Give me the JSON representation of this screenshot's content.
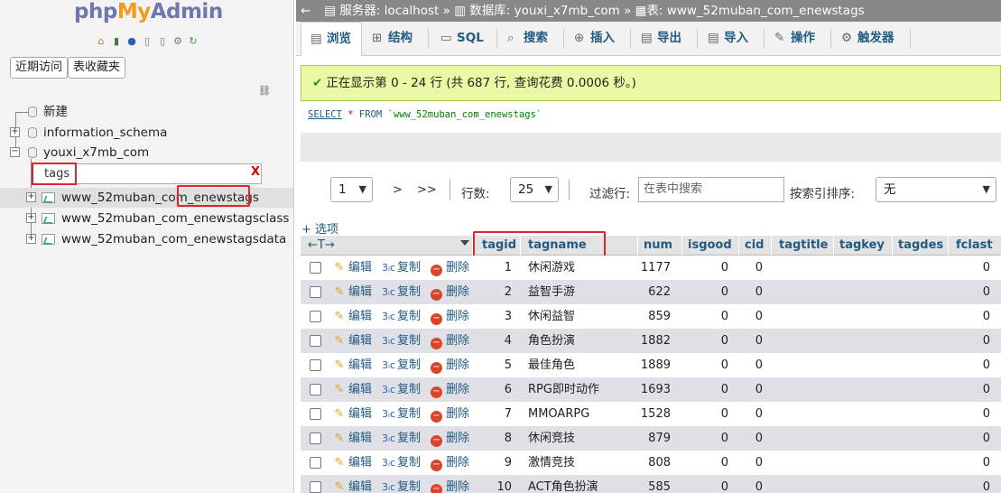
{
  "logo": {
    "php": "php",
    "my": "My",
    "admin": "Admin"
  },
  "nav": {
    "recent_btn": "近期访问",
    "favorites_btn": "表收藏夹",
    "new_label": "新建",
    "databases": [
      "information_schema",
      "youxi_x7mb_com"
    ],
    "filter_value": "tags",
    "filter_clear": "X",
    "tables": [
      "www_52muban_com_enewstags",
      "www_52muban_com_enewstagsclass",
      "www_52muban_com_enewstagsdata"
    ]
  },
  "breadcrumb": {
    "server_label": "服务器:",
    "server": "localhost",
    "db_label": "数据库:",
    "db": "youxi_x7mb_com",
    "table_label": "表:",
    "table": "www_52muban_com_enewstags",
    "separator": "»"
  },
  "tabs": [
    "浏览",
    "结构",
    "SQL",
    "搜索",
    "插入",
    "导出",
    "导入",
    "操作",
    "触发器"
  ],
  "message": {
    "text": "正在显示第 0 - 24 行 (共 687 行, 查询花费 0.0006 秒。)"
  },
  "sql": {
    "select": "SELECT",
    "star": "*",
    "from": "FROM",
    "table": "`www_52muban_com_enewstags`"
  },
  "controls": {
    "page": "1",
    "next": ">",
    "last": ">>",
    "rows_label": "行数:",
    "rows": "25",
    "filter_label": "过滤行:",
    "filter_placeholder": "在表中搜索",
    "sort_label": "按索引排序:",
    "sort_value": "无"
  },
  "options_link": "+ 选项",
  "columns": [
    "tagid",
    "tagname",
    "num",
    "isgood",
    "cid",
    "tagtitle",
    "tagkey",
    "tagdes",
    "fclast"
  ],
  "actions": {
    "edit": "编辑",
    "copy": "复制",
    "delete": "删除"
  },
  "rows": [
    {
      "tagid": "1",
      "tagname": "休闲游戏",
      "num": "1177",
      "isgood": "0",
      "cid": "0",
      "fclast": "0"
    },
    {
      "tagid": "2",
      "tagname": "益智手游",
      "num": "622",
      "isgood": "0",
      "cid": "0",
      "fclast": "0"
    },
    {
      "tagid": "3",
      "tagname": "休闲益智",
      "num": "859",
      "isgood": "0",
      "cid": "0",
      "fclast": "0"
    },
    {
      "tagid": "4",
      "tagname": "角色扮演",
      "num": "1882",
      "isgood": "0",
      "cid": "0",
      "fclast": "0"
    },
    {
      "tagid": "5",
      "tagname": "最佳角色",
      "num": "1889",
      "isgood": "0",
      "cid": "0",
      "fclast": "0"
    },
    {
      "tagid": "6",
      "tagname": "RPG即时动作",
      "num": "1693",
      "isgood": "0",
      "cid": "0",
      "fclast": "0"
    },
    {
      "tagid": "7",
      "tagname": "MMOARPG",
      "num": "1528",
      "isgood": "0",
      "cid": "0",
      "fclast": "0"
    },
    {
      "tagid": "8",
      "tagname": "休闲竞技",
      "num": "879",
      "isgood": "0",
      "cid": "0",
      "fclast": "0"
    },
    {
      "tagid": "9",
      "tagname": "激情竞技",
      "num": "808",
      "isgood": "0",
      "cid": "0",
      "fclast": "0"
    },
    {
      "tagid": "10",
      "tagname": "ACT角色扮演",
      "num": "585",
      "isgood": "0",
      "cid": "0",
      "fclast": "0"
    }
  ],
  "colors": {
    "link": "#235a81",
    "highlight": "#e0242b",
    "success_bg": "#ebf8a4",
    "row_alt": "#dfe1e6"
  }
}
